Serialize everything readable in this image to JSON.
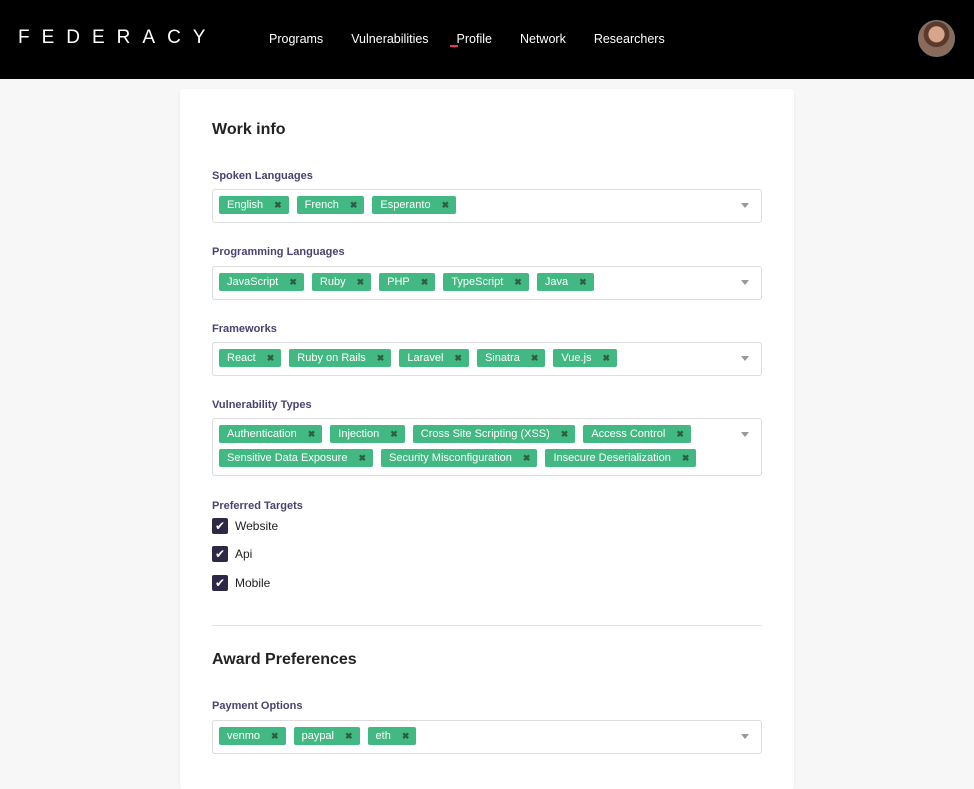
{
  "nav": {
    "logo": "FEDERACY",
    "links": [
      "Programs",
      "Vulnerabilities",
      "Profile",
      "Network",
      "Researchers"
    ],
    "active": "Profile",
    "accent": "#e8356d"
  },
  "work": {
    "title": "Work info",
    "fields": [
      {
        "label": "Spoken Languages",
        "tags": [
          "English",
          "French",
          "Esperanto"
        ]
      },
      {
        "label": "Programming Languages",
        "tags": [
          "JavaScript",
          "Ruby",
          "PHP",
          "TypeScript",
          "Java"
        ]
      },
      {
        "label": "Frameworks",
        "tags": [
          "React",
          "Ruby on Rails",
          "Laravel",
          "Sinatra",
          "Vue.js"
        ]
      },
      {
        "label": "Vulnerability Types",
        "tags": [
          "Authentication",
          "Injection",
          "Cross Site Scripting (XSS)",
          "Access Control",
          "Sensitive Data Exposure",
          "Security Misconfiguration",
          "Insecure Deserialization"
        ]
      }
    ],
    "targets_label": "Preferred Targets",
    "targets": [
      {
        "label": "Website",
        "checked": true
      },
      {
        "label": "Api",
        "checked": true
      },
      {
        "label": "Mobile",
        "checked": true
      }
    ]
  },
  "award": {
    "title": "Award Preferences",
    "payment_label": "Payment Options",
    "payment_tags": [
      "venmo",
      "paypal",
      "eth"
    ]
  },
  "colors": {
    "tag": "#42b883",
    "checkbox": "#2d2845"
  }
}
